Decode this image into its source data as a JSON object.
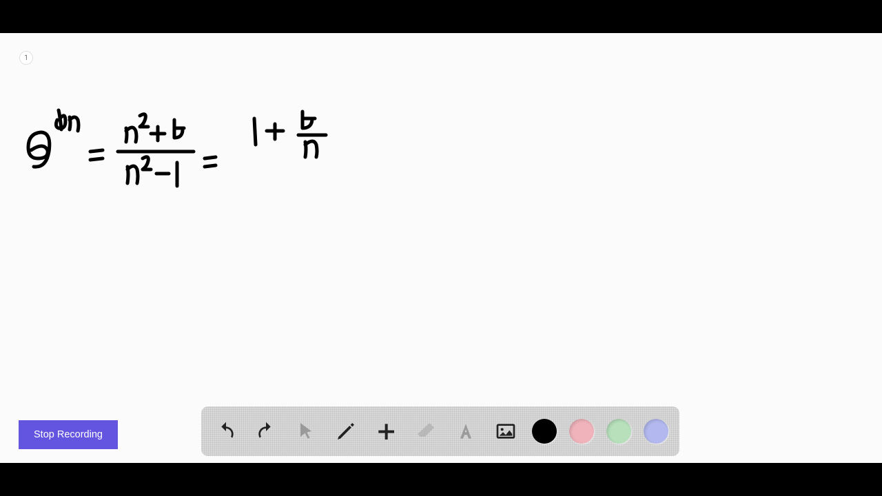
{
  "page_number": "1",
  "stop_button_label": "Stop Recording",
  "colors": {
    "accent": "#6355e0",
    "swatches": [
      "#000000",
      "#f0b3bb",
      "#b7e0bb",
      "#b3b9ef"
    ]
  },
  "toolbar": {
    "undo": "undo-icon",
    "redo": "redo-icon",
    "pointer": "pointer-icon",
    "pen": "pen-icon",
    "add": "plus-icon",
    "eraser": "eraser-icon",
    "text": "text-icon",
    "image": "image-icon"
  },
  "handwritten_math": "e^{dn} = (n^2+4)/(n^2-1) = 1 + 4/n"
}
